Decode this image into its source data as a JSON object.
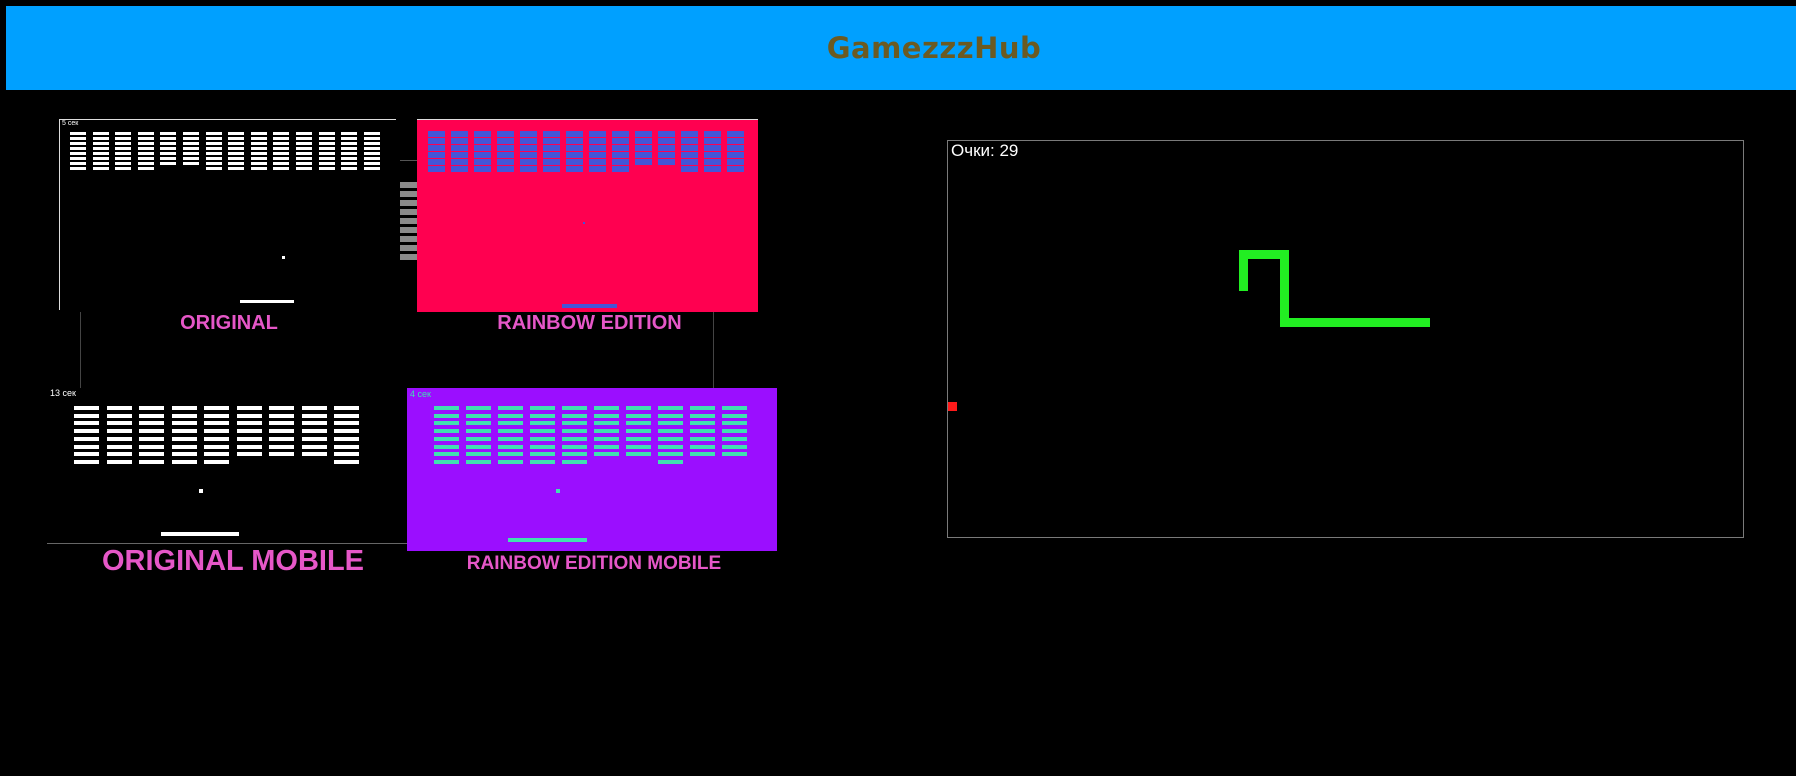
{
  "header": {
    "title": "GamezzzHub"
  },
  "games": {
    "original": {
      "caption": "ORIGINAL",
      "timer": "5 сек",
      "brick_color": "#ffffff",
      "bg_color": "#000000",
      "short_columns": [
        4,
        5
      ]
    },
    "rainbow": {
      "caption": "RAINBOW EDITION",
      "timer": "",
      "brick_color": "#4455d8",
      "bg_color": "#ff0050",
      "short_columns": [
        9,
        10
      ]
    },
    "original_mobile": {
      "caption": "ORIGINAL MOBILE",
      "timer": "13 сек",
      "brick_color": "#ffffff",
      "bg_color": "#000000",
      "short_columns": [
        5,
        6,
        7,
        9
      ]
    },
    "rainbow_mobile": {
      "caption": "RAINBOW EDITION MOBILE",
      "timer": "4 сек",
      "brick_color": "#40e0b0",
      "bg_color": "#9b0eff",
      "short_columns": [
        5,
        6,
        8,
        9
      ]
    }
  },
  "snake": {
    "score_label": "Очки: 29",
    "snake_color": "#22ee22",
    "food_color": "#ff1a1a",
    "board_border_color": "#7a7a7a"
  }
}
